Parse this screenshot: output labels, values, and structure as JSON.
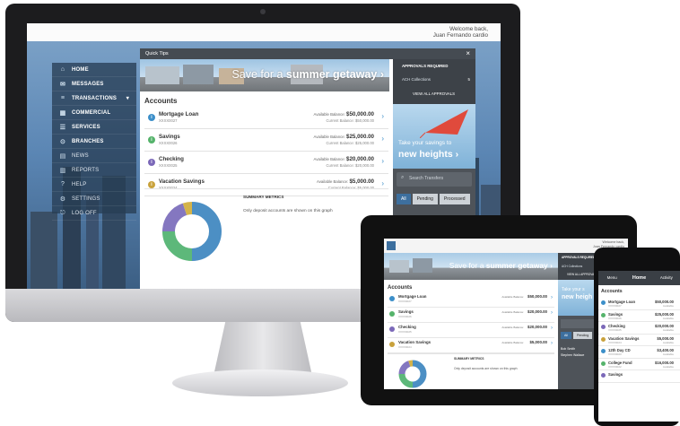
{
  "desktop": {
    "welcome": "Welcome back,",
    "user_name": "Juan Fernando cardio",
    "quick_tips": "Quick Tips",
    "close": "×",
    "banner": {
      "prefix": "Save for a ",
      "bold": "summer getaway",
      "arrow": "›"
    },
    "nav": [
      {
        "icon": "⌂",
        "label": "HOME",
        "name": "home"
      },
      {
        "icon": "✉",
        "label": "MESSAGES",
        "name": "messages"
      },
      {
        "icon": "≡",
        "label": "TRANSACTIONS",
        "name": "transactions",
        "caret": "▾"
      },
      {
        "icon": "▦",
        "label": "COMMERCIAL",
        "name": "commercial"
      },
      {
        "icon": "☰",
        "label": "SERVICES",
        "name": "services"
      },
      {
        "icon": "⊙",
        "label": "BRANCHES",
        "name": "branches"
      },
      {
        "icon": "▤",
        "label": "NEWS",
        "name": "news"
      },
      {
        "icon": "▥",
        "label": "REPORTS",
        "name": "reports"
      },
      {
        "icon": "?",
        "label": "HELP",
        "name": "help"
      },
      {
        "icon": "⚙",
        "label": "SETTINGS",
        "name": "settings"
      },
      {
        "icon": "⎋",
        "label": "LOG OFF",
        "name": "log-off"
      }
    ],
    "accounts_title": "Accounts",
    "accounts": [
      {
        "name": "Mortgage Loan",
        "number": "XXXX0027",
        "available_label": "Available Balance:",
        "available": "$50,000.00",
        "current": "Current Balance: $50,000.00",
        "color": "#3c8fc9"
      },
      {
        "name": "Savings",
        "number": "XXXX0026",
        "available_label": "Available Balance:",
        "available": "$25,000.00",
        "current": "Current Balance: $25,000.00",
        "color": "#55b36b"
      },
      {
        "name": "Checking",
        "number": "XXXX0025",
        "available_label": "Available Balance:",
        "available": "$20,000.00",
        "current": "Current Balance: $20,000.00",
        "color": "#7b68b8"
      },
      {
        "name": "Vacation Savings",
        "number": "XXXX0024",
        "available_label": "Available Balance:",
        "available": "$5,000.00",
        "current": "Current Balance: $5,000.00",
        "color": "#c9a23c"
      }
    ],
    "chev": "›",
    "summary_title": "SUMMARY METRICS",
    "summary_note": "Only deposit accounts are shown on this graph",
    "donut": {
      "segments": [
        {
          "value": 50,
          "color": "#4c8fc4"
        },
        {
          "value": 25,
          "color": "#5db87a"
        },
        {
          "value": 20,
          "color": "#8477c0"
        },
        {
          "value": 5,
          "color": "#d4b349"
        }
      ]
    },
    "approvals": {
      "title": "APPROVALS REQUIRED",
      "item1": "ACH Collections",
      "item1_count": "5",
      "view_all": "VIEW ALL APPROVALS"
    },
    "kite_text": {
      "line1": "Take your savings to",
      "line2": "new heights",
      "arrow": "›"
    },
    "search_placeholder": "Search Transfers",
    "tabs": [
      "All",
      "Pending",
      "Processed"
    ]
  },
  "tablet": {
    "welcome": "Welcome back,",
    "user_name": "Juan Fernando cardio",
    "banner": {
      "prefix": "Save for a ",
      "bold": "summer getaway",
      "arrow": "›"
    },
    "approvals": {
      "title": "APPROVALS REQUIRED",
      "item1": "ACH Collections",
      "view_all": "VIEW ALL APPROVALS"
    },
    "accounts_title": "Accounts",
    "accounts": [
      {
        "name": "Mortgage Loan",
        "number": "XXXX0027",
        "available": "$50,000.00",
        "color": "#3c8fc9"
      },
      {
        "name": "Savings",
        "number": "XXXX0026",
        "available": "$20,000.00",
        "color": "#55b36b"
      },
      {
        "name": "Checking",
        "number": "XXXX0025",
        "available": "$20,000.00",
        "color": "#7b68b8"
      },
      {
        "name": "Vacation Savings",
        "number": "XXXX0024",
        "available": "$5,000.00",
        "color": "#c9a23c"
      }
    ],
    "available_label": "Available Balance:",
    "summary_title": "SUMMARY METRICS",
    "summary_note": "Only deposit accounts are shown on this graph",
    "kite_text": {
      "line1": "Take your s",
      "line2": "new heigh"
    },
    "tabs": [
      "All",
      "Pending"
    ],
    "people": [
      "Bob Smith",
      "Stephen Wallace"
    ]
  },
  "phone": {
    "tabs": [
      "Menu",
      "Home",
      "Activity"
    ],
    "accounts_title": "Accounts",
    "accounts": [
      {
        "name": "Mortgage Loan",
        "number": "XXXX0027",
        "amount": "$50,000.00",
        "label": "Available",
        "color": "#3c8fc9"
      },
      {
        "name": "Savings",
        "number": "XXXX0026",
        "amount": "$25,000.00",
        "label": "Available",
        "color": "#55b36b"
      },
      {
        "name": "Checking",
        "number": "XXXX0025",
        "amount": "$20,000.00",
        "label": "Available",
        "color": "#7b68b8"
      },
      {
        "name": "Vacation Savings",
        "number": "XXXX0024",
        "amount": "$5,000.00",
        "label": "Available",
        "color": "#c9a23c"
      },
      {
        "name": "12th Day CD",
        "number": "XXXX0023",
        "amount": "$3,400.00",
        "label": "Available",
        "color": "#3c8fc9"
      },
      {
        "name": "College Fund",
        "number": "XXXX0022",
        "amount": "$16,000.00",
        "label": "Available",
        "color": "#55b36b"
      },
      {
        "name": "Savings",
        "number": "",
        "amount": "",
        "label": "",
        "color": "#7b68b8"
      }
    ]
  }
}
